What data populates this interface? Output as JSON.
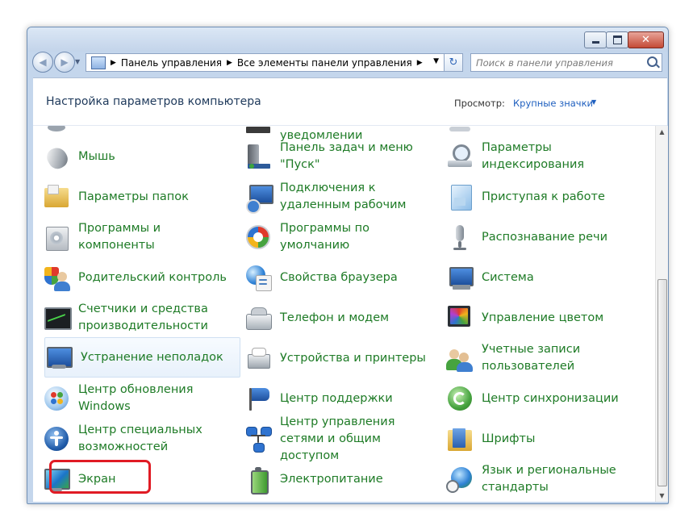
{
  "window": {
    "controls": {
      "minimize_icon": "minimize-icon",
      "maximize_icon": "maximize-icon",
      "close_icon": "close-icon"
    }
  },
  "navigation": {
    "breadcrumbs": [
      "Панель управления",
      "Все элементы панели управления"
    ],
    "search_placeholder": "Поиск в панели управления"
  },
  "header": {
    "title": "Настройка параметров компьютера",
    "view_label": "Просмотр:",
    "view_value": "Крупные значки"
  },
  "partial_row": {
    "col2_label": "уведомлении"
  },
  "items": [
    {
      "label": "Мышь",
      "icon": "mouse-icon"
    },
    {
      "label": "Панель задач и меню \"Пуск\"",
      "icon": "taskbar-icon"
    },
    {
      "label": "Параметры индексирования",
      "icon": "indexing-icon"
    },
    {
      "label": "Параметры папок",
      "icon": "folder-icon"
    },
    {
      "label": "Подключения к удаленным рабочим",
      "icon": "remote-desktop-icon"
    },
    {
      "label": "Приступая к работе",
      "icon": "getting-started-icon"
    },
    {
      "label": "Программы и компоненты",
      "icon": "programs-icon"
    },
    {
      "label": "Программы по умолчанию",
      "icon": "default-programs-icon"
    },
    {
      "label": "Распознавание речи",
      "icon": "microphone-icon"
    },
    {
      "label": "Родительский контроль",
      "icon": "parental-control-icon"
    },
    {
      "label": "Свойства браузера",
      "icon": "browser-icon"
    },
    {
      "label": "Система",
      "icon": "system-icon"
    },
    {
      "label": "Счетчики и средства производительности",
      "icon": "performance-icon"
    },
    {
      "label": "Телефон и модем",
      "icon": "phone-modem-icon"
    },
    {
      "label": "Управление цветом",
      "icon": "color-management-icon"
    },
    {
      "label": "Устранение неполадок",
      "icon": "troubleshooting-icon",
      "hover": true
    },
    {
      "label": "Устройства и принтеры",
      "icon": "printer-icon"
    },
    {
      "label": "Учетные записи пользователей",
      "icon": "user-accounts-icon"
    },
    {
      "label": "Центр обновления Windows",
      "icon": "windows-update-icon"
    },
    {
      "label": "Центр поддержки",
      "icon": "action-center-flag-icon"
    },
    {
      "label": "Центр синхронизации",
      "icon": "sync-center-icon"
    },
    {
      "label": "Центр специальных возможностей",
      "icon": "accessibility-icon"
    },
    {
      "label": "Центр управления сетями и общим доступом",
      "icon": "network-icon"
    },
    {
      "label": "Шрифты",
      "icon": "fonts-folder-icon"
    },
    {
      "label": "Экран",
      "icon": "display-icon",
      "highlighted": true
    },
    {
      "label": "Электропитание",
      "icon": "power-icon"
    },
    {
      "label": "Язык и региональные стандарты",
      "icon": "globe-clock-icon"
    }
  ],
  "colors": {
    "link_green": "#1e7b26",
    "title_blue": "#1e395b",
    "accent_blue": "#1e5fbf",
    "highlight_red": "#e01b24"
  }
}
